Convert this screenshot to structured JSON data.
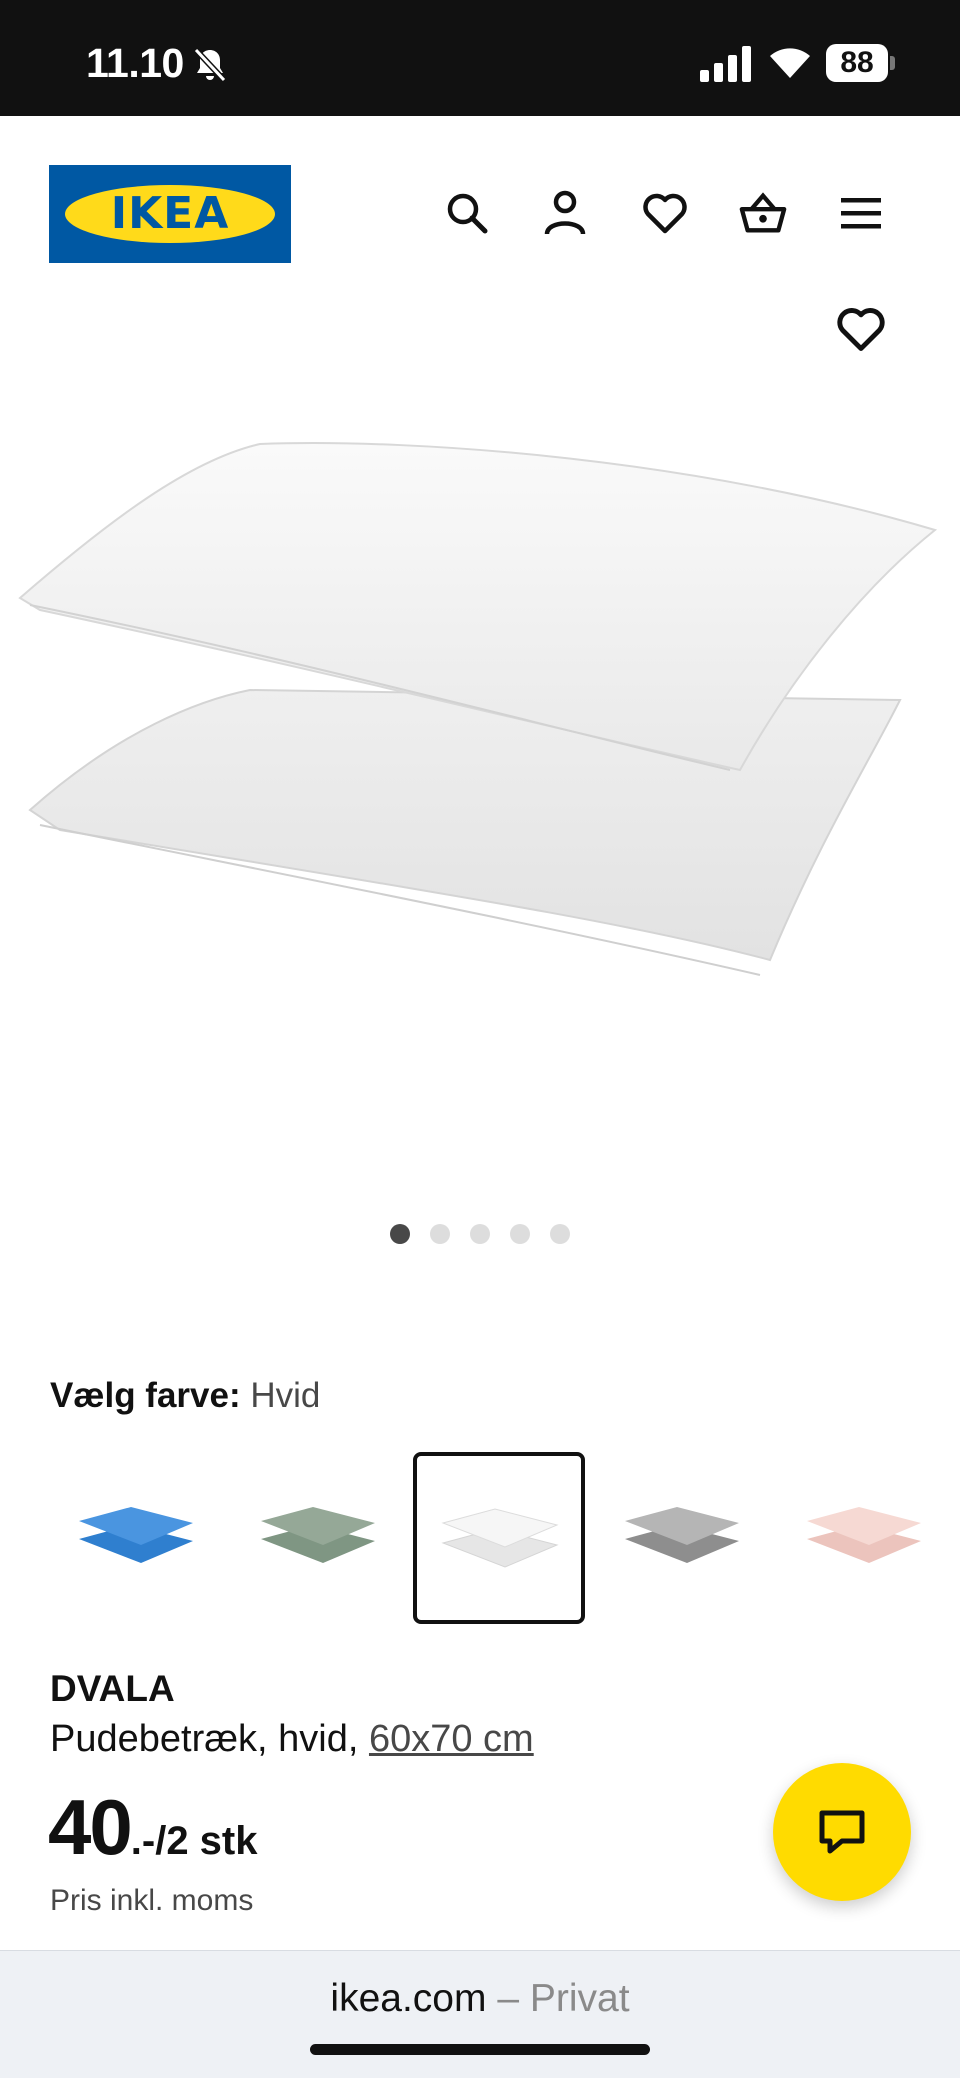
{
  "status_bar": {
    "time": "11.10",
    "battery": "88",
    "icons": [
      "bell-mute-icon",
      "signal-icon",
      "wifi-icon",
      "battery-icon"
    ]
  },
  "header": {
    "logo_text": "IKEA",
    "icons": [
      "search-icon",
      "account-icon",
      "favorites-heart-icon",
      "shopping-basket-icon",
      "menu-icon"
    ]
  },
  "gallery": {
    "image_count": 5,
    "active_index": 0
  },
  "color_picker": {
    "label": "Vælg farve:",
    "selected": "Hvid",
    "options": [
      {
        "name": "blue",
        "color": "#3a8ad8"
      },
      {
        "name": "green",
        "color": "#8a9e8c"
      },
      {
        "name": "white",
        "color": "#f2f2f2"
      },
      {
        "name": "grey",
        "color": "#a8a8a8"
      },
      {
        "name": "pink",
        "color": "#f2cfc8"
      }
    ]
  },
  "product": {
    "name": "DVALA",
    "description": "Pudebetræk, hvid,",
    "size": "60x70 cm",
    "price_int": "40",
    "price_suffix": ".-/2 stk",
    "price_note": "Pris inkl. moms"
  },
  "browser": {
    "domain": "ikea.com",
    "separator": " – ",
    "mode": "Privat"
  },
  "colors": {
    "ikea_blue": "#0058a3",
    "ikea_yellow": "#ffda1a",
    "chat_yellow": "#ffdb00"
  }
}
